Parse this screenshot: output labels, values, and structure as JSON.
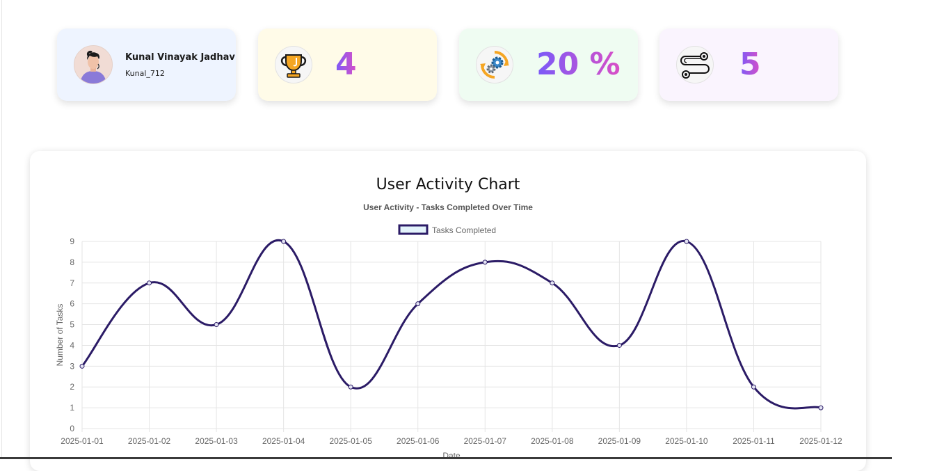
{
  "profile": {
    "name": "Kunal Vinayak Jadhav",
    "handle": "Kunal_712",
    "avatar_icon": "avatar-icon"
  },
  "stats": [
    {
      "icon": "trophy-icon",
      "value": "4"
    },
    {
      "icon": "gears-icon",
      "value": "20 %"
    },
    {
      "icon": "route-icon",
      "value": "5"
    }
  ],
  "colors": {
    "line": "#2b1b66",
    "legend_fill": "#e3f3fb",
    "accent_start": "#7a5af8",
    "accent_end": "#d94fc6"
  },
  "chart_heading": "User Activity Chart",
  "chart_data": {
    "type": "line",
    "title": "User Activity - Tasks Completed Over Time",
    "xlabel": "Date",
    "ylabel": "Number of Tasks",
    "categories": [
      "2025-01-01",
      "2025-01-02",
      "2025-01-03",
      "2025-01-04",
      "2025-01-05",
      "2025-01-06",
      "2025-01-07",
      "2025-01-08",
      "2025-01-09",
      "2025-01-10",
      "2025-01-11",
      "2025-01-12"
    ],
    "series": [
      {
        "name": "Tasks Completed",
        "values": [
          3,
          7,
          5,
          9,
          2,
          6,
          8,
          7,
          4,
          9,
          2,
          1
        ]
      }
    ],
    "ylim": [
      0,
      9
    ],
    "yticks": [
      0,
      1,
      2,
      3,
      4,
      5,
      6,
      7,
      8,
      9
    ],
    "grid": true,
    "legend": "top-center"
  }
}
